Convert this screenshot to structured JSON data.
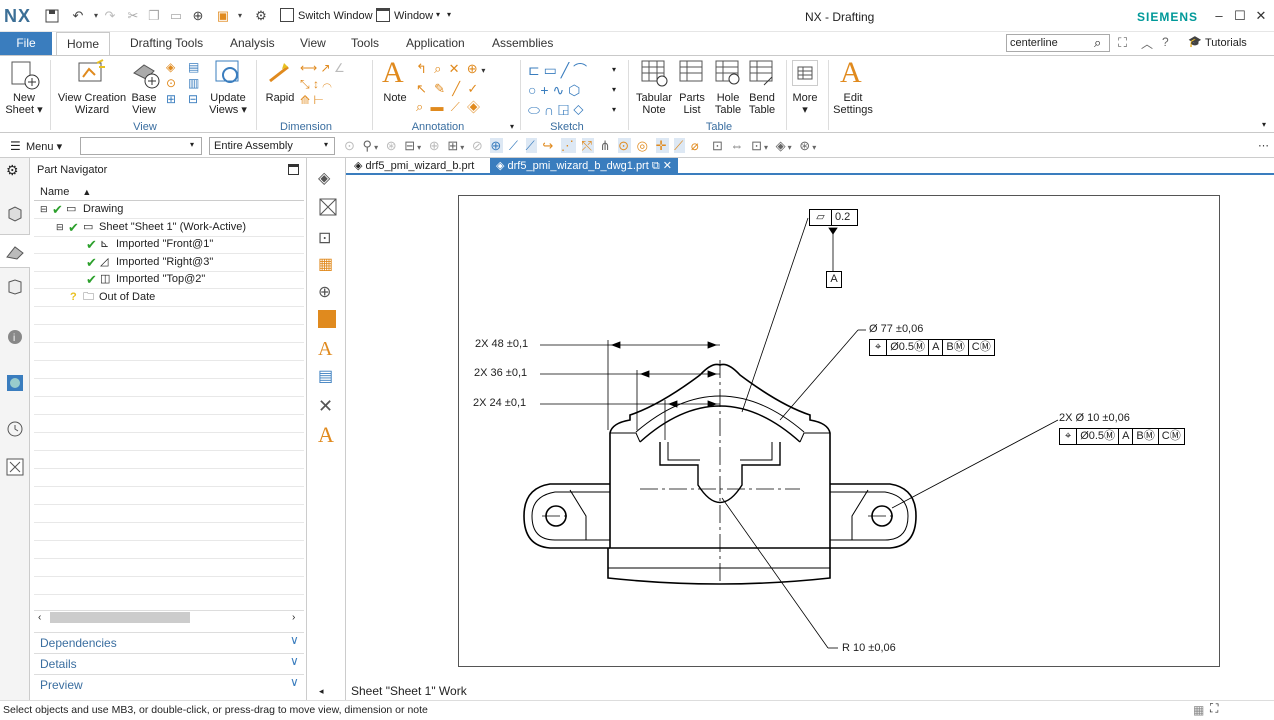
{
  "app": {
    "logo": "NX",
    "title": "NX - Drafting",
    "brand": "SIEMENS",
    "brand_color": "#009999",
    "accent": "#3a7dbe"
  },
  "quick_access": {
    "switch_window": "Switch Window",
    "window_menu": "Window"
  },
  "tabs": [
    "File",
    "Home",
    "Drafting Tools",
    "Analysis",
    "View",
    "Tools",
    "Application",
    "Assemblies"
  ],
  "search": {
    "value": "centerline"
  },
  "tutorials": "Tutorials",
  "ribbon": {
    "new_sheet": [
      "New",
      "Sheet"
    ],
    "view_creation": [
      "View Creation",
      "Wizard"
    ],
    "base_view": [
      "Base",
      "View"
    ],
    "update_views": [
      "Update",
      "Views"
    ],
    "rapid": "Rapid",
    "note": "Note",
    "tabular_note": [
      "Tabular",
      "Note"
    ],
    "parts_list": [
      "Parts",
      "List"
    ],
    "hole_table": [
      "Hole",
      "Table"
    ],
    "bend_table": [
      "Bend",
      "Table"
    ],
    "more": "More",
    "edit_settings": [
      "Edit",
      "Settings"
    ],
    "groups": {
      "view": "View",
      "dimension": "Dimension",
      "annotation": "Annotation",
      "sketch": "Sketch",
      "table": "Table"
    }
  },
  "toolbar": {
    "menu": "Menu",
    "filter_value": "",
    "scope": "Entire Assembly"
  },
  "navigator": {
    "title": "Part Navigator",
    "column": "Name",
    "rows": [
      {
        "label": "Drawing"
      },
      {
        "label": "Sheet \"Sheet 1\" (Work-Active)"
      },
      {
        "label": "Imported \"Front@1\""
      },
      {
        "label": "Imported \"Right@3\""
      },
      {
        "label": "Imported \"Top@2\""
      },
      {
        "label": "Out of Date"
      }
    ],
    "panels": [
      "Dependencies",
      "Details",
      "Preview"
    ]
  },
  "doc_tabs": [
    "drf5_pmi_wizard_b.prt",
    "drf5_pmi_wizard_b_dwg1.prt"
  ],
  "drawing": {
    "flatness": "0.2",
    "datum_a": "A",
    "dim_48": "2X  48  ±0,1",
    "dim_36": "2X  36  ±0,1",
    "dim_24": "2X  24  ±0,1",
    "dia77": "Ø  77  ±0,06",
    "fcf1": [
      "⌖",
      "Ø0.5Ⓜ",
      "A",
      "BⓂ",
      "CⓂ"
    ],
    "dia10": "2X  Ø  10  ±0,06",
    "fcf2": [
      "⌖",
      "Ø0.5Ⓜ",
      "A",
      "BⓂ",
      "CⓂ"
    ],
    "radius": "R  10  ±0,06",
    "sheet_label": "Sheet \"Sheet 1\" Work"
  },
  "status": "Select objects and use MB3, or double-click, or press-drag to move view, dimension or note"
}
